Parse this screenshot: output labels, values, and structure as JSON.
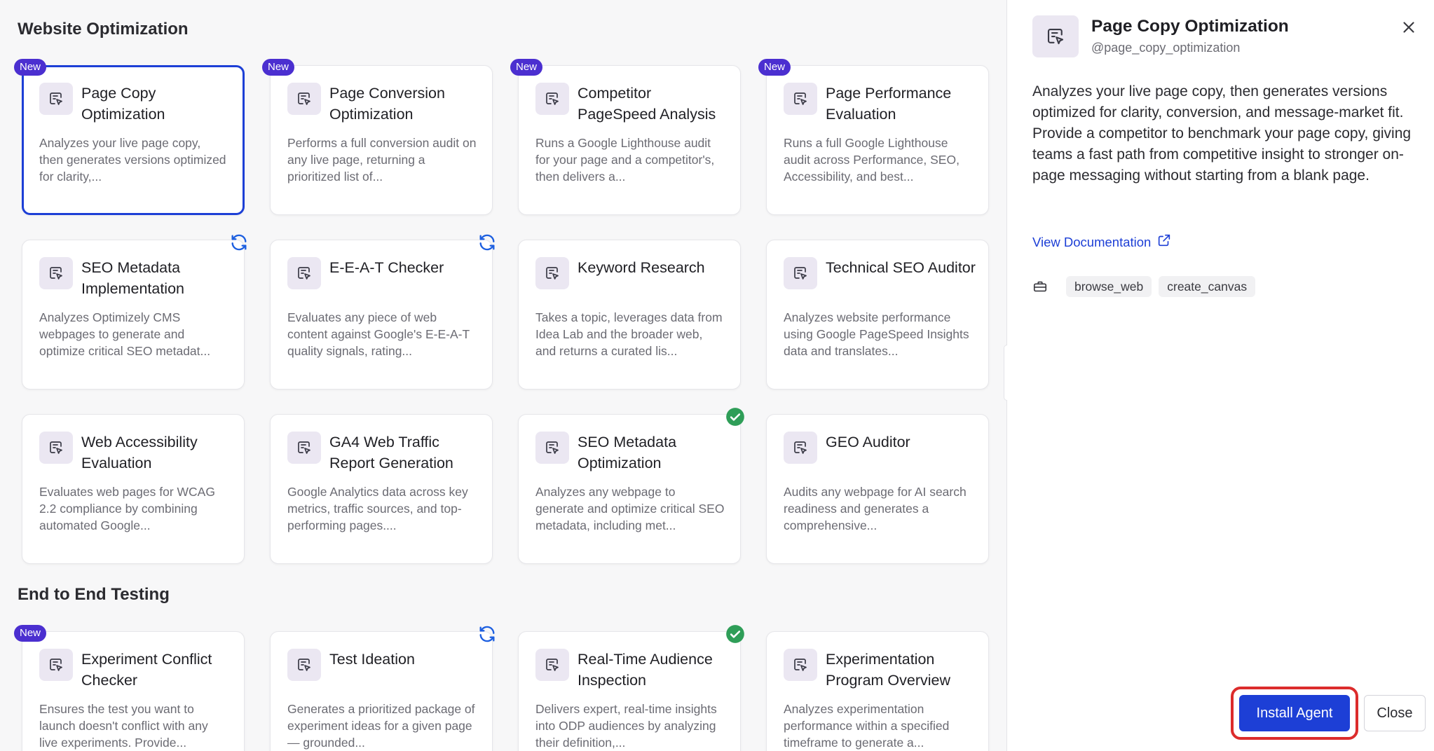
{
  "sections": [
    {
      "title": "Website Optimization",
      "cards": [
        {
          "title": "Page Copy Optimization",
          "desc": "Analyzes your live page copy, then generates versions optimized for clarity,...",
          "badge": "New",
          "selected": true
        },
        {
          "title": "Page Conversion Optimization",
          "desc": "Performs a full conversion audit on any live page, returning a prioritized list of...",
          "badge": "New"
        },
        {
          "title": "Competitor PageSpeed Analysis",
          "desc": "Runs a Google Lighthouse audit for your page and a competitor's, then delivers a...",
          "badge": "New"
        },
        {
          "title": "Page Performance Evaluation",
          "desc": "Runs a full Google Lighthouse audit across Performance, SEO, Accessibility, and best...",
          "badge": "New"
        },
        {
          "title": "SEO Metadata Implementation",
          "desc": "Analyzes Optimizely CMS webpages to generate and optimize critical SEO metadat...",
          "status": "update-icon"
        },
        {
          "title": "E-E-A-T Checker",
          "desc": "Evaluates any piece of web content against Google's E-E-A-T quality signals, rating...",
          "status": "update-icon"
        },
        {
          "title": "Keyword Research",
          "desc": "Takes a topic, leverages data from Idea Lab and the broader web, and returns a curated lis..."
        },
        {
          "title": "Technical SEO Auditor",
          "desc": "Analyzes website performance using Google PageSpeed Insights data and translates..."
        },
        {
          "title": "Web Accessibility Evaluation",
          "desc": "Evaluates web pages for WCAG 2.2 compliance by combining automated Google..."
        },
        {
          "title": "GA4 Web Traffic Report Generation",
          "desc": "Google Analytics data across key metrics, traffic sources, and top-performing pages...."
        },
        {
          "title": "SEO Metadata Optimization",
          "desc": "Analyzes any webpage to generate and optimize critical SEO metadata, including met...",
          "status": "installed-icon"
        },
        {
          "title": "GEO Auditor",
          "desc": "Audits any webpage for AI search readiness and generates a comprehensive..."
        }
      ]
    },
    {
      "title": "End to End Testing",
      "cards": [
        {
          "title": "Experiment Conflict Checker",
          "desc": "Ensures the test you want to launch doesn't conflict with any live experiments. Provide...",
          "badge": "New"
        },
        {
          "title": "Test Ideation",
          "desc": "Generates a prioritized package of experiment ideas for a given page — grounded...",
          "status": "update-icon"
        },
        {
          "title": "Real-Time Audience Inspection",
          "desc": "Delivers expert, real-time insights into ODP audiences by analyzing their definition,...",
          "status": "installed-icon"
        },
        {
          "title": "Experimentation Program Overview",
          "desc": "Analyzes experimentation performance within a specified timeframe to generate a..."
        }
      ]
    }
  ],
  "panel": {
    "title": "Page Copy Optimization",
    "handle": "@page_copy_optimization",
    "description": "Analyzes your live page copy, then generates versions optimized for clarity, conversion, and message-market fit. Provide a competitor to benchmark your page copy, giving teams a fast path from competitive insight to stronger on-page messaging without starting from a blank page.",
    "doc_link": "View Documentation",
    "tools": [
      "browse_web",
      "create_canvas"
    ],
    "install_label": "Install Agent",
    "close_label": "Close"
  },
  "colors": {
    "accent": "#1d3fd6",
    "badge": "#4b2fd0",
    "installed": "#2f9e58",
    "highlight": "#dc2c2c"
  }
}
